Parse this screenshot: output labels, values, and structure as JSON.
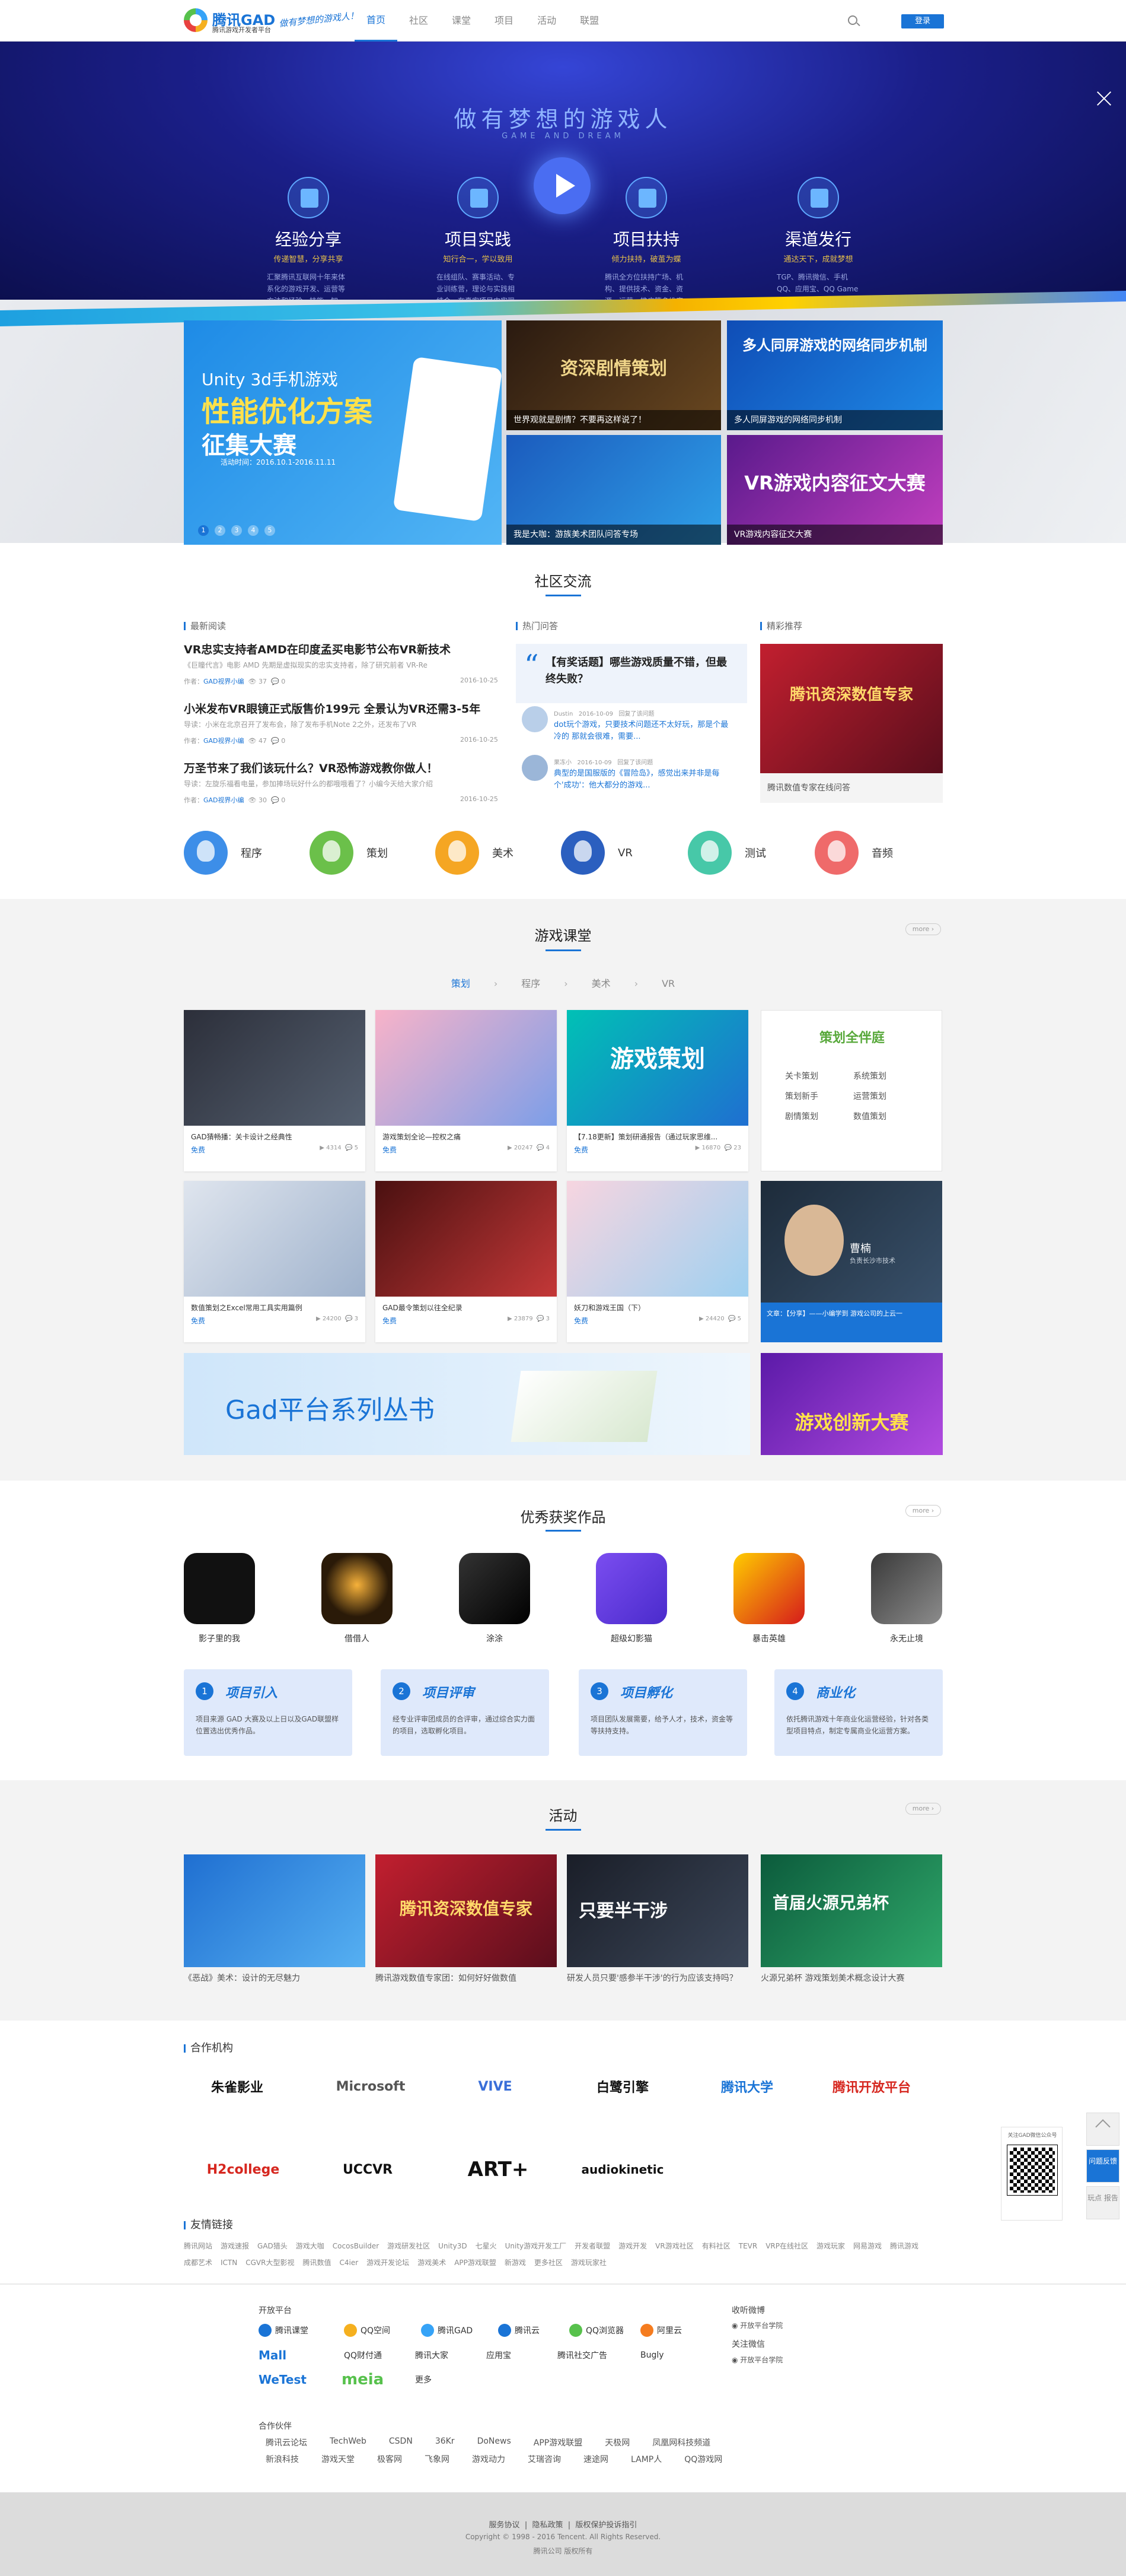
{
  "header": {
    "logo_text": "腾讯GAD",
    "logo_sub": "腾讯游戏开发者平台",
    "slogan": "做有梦想的游戏人！",
    "nav": [
      "首页",
      "社区",
      "课堂",
      "项目",
      "活动",
      "联盟"
    ],
    "login": "登录"
  },
  "banner": {
    "title": "做有梦想的游戏人",
    "subtitle": "GAME AND DREAM",
    "features": [
      {
        "title": "经验分享",
        "slogan": "传递智慧，分享共享",
        "desc": "汇聚腾讯互联网十年来体系化的游戏开发、运营等方法和经验、技能、知识、工具。传播知识，反哺行业。"
      },
      {
        "title": "项目实践",
        "slogan": "知行合一，学以致用",
        "desc": "在线组队、赛事活动、专业训练营，理论与实践相结合，在真实项目中实现团队的能力合一，共同成长。"
      },
      {
        "title": "项目扶持",
        "slogan": "倾力扶持，破茧为蝶",
        "desc": "腾讯全方位扶持广场、机构、提供技术、资金、资源、运营、推广等多维度扶持，全力扶持刚开发团队成长。"
      },
      {
        "title": "渠道发行",
        "slogan": "通达天下，成就梦想",
        "desc": "TGP、腾讯微信、手机QQ、应用宝、QQ Game腾讯多平台全渠道覆盖的渠道优势，帮你实现游戏的梦想。"
      }
    ]
  },
  "carousel": {
    "main": {
      "line1": "Unity 3d手机游戏",
      "line2": "性能优化方案",
      "line3": "征集大赛",
      "date": "活动时间：2016.10.1-2016.11.11"
    },
    "dots": [
      "1",
      "2",
      "3",
      "4",
      "5"
    ],
    "tiles": [
      {
        "head": "资深剧情策划",
        "cap": "世界观就是剧情？不要再这样说了！"
      },
      {
        "head": "多人同屏游戏的网络同步机制",
        "cap": "多人同屏游戏的网络同步机制"
      },
      {
        "head": "",
        "cap": "我是大咖：游族美术团队问答专场"
      },
      {
        "head": "VR游戏内容征文大赛",
        "cap": "VR游戏内容征文大赛"
      }
    ]
  },
  "community": {
    "title": "社区交流",
    "latest_label": "最新阅读",
    "hot_label": "热门问答",
    "featured_label": "精彩推荐",
    "news": [
      {
        "title": "VR忠实支持者AMD在印度孟买电影节公布VR新技术",
        "desc": "《巨瞳代言》电影      AMD 先期是虚拟现实的忠实支持者，除了研究前者 VR-Re",
        "author": "GAD视界小编",
        "views": "37",
        "comments": "0",
        "date": "2016-10-25"
      },
      {
        "title": "小米发布VR眼镜正式版售价199元 全景认为VR还需3-5年",
        "desc": "导读：小米在北京召开了发布会，除了发布手机Note 2之外，还发布了VR",
        "author": "GAD视界小编",
        "views": "47",
        "comments": "0",
        "date": "2016-10-25"
      },
      {
        "title": "万圣节来了我们该玩什么？VR恐怖游戏教你做人！",
        "desc": "导读：左旋乐福看电量，参加捧场玩好什么的都哦哦看了？小编今天给大家介绍",
        "author": "GAD视界小编",
        "views": "30",
        "comments": "0",
        "date": "2016-10-25"
      }
    ],
    "qa": {
      "question": "【有奖话题】哪些游戏质量不错，但最终失败？",
      "answers": [
        {
          "user": "Dustin",
          "time": "2016-10-09",
          "tag": "回复了该问题",
          "text": "dot玩个游戏，只要技术问题还不太好玩，那是个最冷的 那就会很难，需要..."
        },
        {
          "user": "果冻小",
          "time": "2016-10-09",
          "tag": "回复了该问题",
          "text": "典型的是国服版的《冒险岛》，感觉出来并非是每个'成功'：他大都分的游戏..."
        }
      ]
    },
    "featured": {
      "cap": "腾讯数值专家在线问答",
      "head": "腾讯资深数值专家"
    },
    "skills": [
      "程序",
      "策划",
      "美术",
      "VR",
      "测试",
      "音频"
    ]
  },
  "course": {
    "title": "游戏课堂",
    "more": "more ›",
    "tabs": [
      "策划",
      "程序",
      "美术",
      "VR"
    ],
    "cards": [
      {
        "title": "GAD猜畅播：关卡设计之经典性",
        "free": "免费",
        "views": "4314",
        "comments": "5"
      },
      {
        "title": "游戏策划全论—控权之痛",
        "free": "免费",
        "views": "20247",
        "comments": "4"
      },
      {
        "title": "【7.18更新】策划研通报告（通过玩家思维...",
        "free": "免费",
        "views": "16870",
        "comments": "23",
        "head": "游戏策划"
      },
      {
        "title": "数值策划之Excel常用工具实用篇例",
        "free": "免费",
        "views": "24200",
        "comments": "3"
      },
      {
        "title": "GAD最令策划以往全纪录",
        "free": "免费",
        "views": "23879",
        "comments": "3"
      },
      {
        "title": "妖刀和游戏王国（下）",
        "free": "免费",
        "views": "24420",
        "comments": "5"
      }
    ],
    "planner": {
      "title": "策划全伴庭",
      "items": [
        "关卡策划",
        "系统策划",
        "策划新手",
        "运营策划",
        "剧情策划",
        "数值策划"
      ]
    },
    "teacher": {
      "name": "曹楠",
      "role": "负责长沙市技术",
      "cap": "文章：【分享】——小编学到 游戏公司的上云一"
    },
    "book_banner": "Gad平台系列丛书",
    "game_banner": "游戏创新大赛"
  },
  "awards": {
    "title": "优秀获奖作品",
    "more": "more ›",
    "items": [
      "影子里的我",
      "借借人",
      "涂涂",
      "超级幻影猫",
      "暴击英雄",
      "永无止境"
    ],
    "steps": [
      {
        "n": "1",
        "title": "项目引入",
        "desc": "项目来源 GAD 大赛及以上日以及GAD联盟样位置选出优秀作品。"
      },
      {
        "n": "2",
        "title": "项目评审",
        "desc": "经专业评审团成员的合评审，通过综合实力面的项目，选取孵化项目。"
      },
      {
        "n": "3",
        "title": "项目孵化",
        "desc": "项目团队发展需要，给予人才，技术，资金等等扶持支持。"
      },
      {
        "n": "4",
        "title": "商业化",
        "desc": "依托腾讯游戏十年商业化运营经验，针对各类型项目特点，制定专属商业化运营方案。"
      }
    ]
  },
  "activity": {
    "title": "活动",
    "more": "more ›",
    "items": [
      "《恶战》美术：设计的无尽魅力",
      "腾讯游戏数值专家团：如何好好做数值",
      "研发人员只要'感参半干涉'的行为应该支持吗？",
      "火源兄弟杯 游戏策划美术概念设计大赛"
    ],
    "heads": [
      "",
      "腾讯资深数值专家",
      "只要半干涉",
      "首届火源兄弟杯"
    ]
  },
  "partners": {
    "label": "合作机构",
    "items": [
      "朱雀影业",
      "Microsoft",
      "VIVE",
      "白鹭引擎",
      "腾讯大学",
      "腾讯开放平台",
      "H2college",
      "UCCVR",
      "ART+",
      "audiokinetic"
    ]
  },
  "friend_links": {
    "label": "友情链接",
    "row1": [
      "腾讯网站",
      "游戏速报",
      "GAD猎头",
      "游戏大咖",
      "CocosBuilder",
      "游戏研发社区",
      "Unity3D",
      "七星火",
      "Unity游戏开发工厂",
      "开发者联盟",
      "游戏开发",
      "VR游戏社区",
      "有料社区",
      "TEVR",
      "VRP在线社区",
      "游戏玩家",
      "网易游戏",
      "腾讯游戏"
    ],
    "row2": [
      "成都艺术",
      "ICTN",
      "CGVR大型影视",
      "腾讯数值",
      "C4ier",
      "游戏开发论坛",
      "游戏美术",
      "APP游戏联盟",
      "新游戏",
      "更多社区",
      "游戏玩家社"
    ]
  },
  "footer": {
    "open_label": "开放平台",
    "coop_label": "合作伙伴",
    "follow_label": "收听微博",
    "wx_label": "关注微信",
    "open_logos": [
      "腾讯课堂",
      "QQ空间",
      "腾讯GAD",
      "腾讯云",
      "QQ浏览器",
      "阿里云",
      "Mall",
      "QQ财付通",
      "腾讯大家",
      "应用宝",
      "腾讯社交广告",
      "Bugly",
      "WeTest",
      "meia",
      "更多"
    ],
    "weibo": "开放平台学院",
    "wechat": "开放平台学院",
    "coop_row1": [
      "腾讯云论坛",
      "TechWeb",
      "CSDN",
      "36Kr",
      "DoNews",
      "APP游戏联盟",
      "天极网",
      "凤凰网科技频道"
    ],
    "coop_row2": [
      "新浪科技",
      "游戏天堂",
      "极客网",
      "飞象网",
      "游戏动力",
      "艾瑞咨询",
      "速途网",
      "LAMP人",
      "QQ游戏网"
    ]
  },
  "bottom": {
    "links": [
      "服务协议",
      "隐私政策",
      "版权保护投诉指引"
    ],
    "copyright": "Copyright © 1998 - 2016 Tencent. All Rights Reserved.",
    "company": "腾讯公司 版权所有"
  },
  "side": {
    "qr_label": "关注GAD微信公众号",
    "btn1": "回到顶部",
    "btn2": "问题反馈",
    "btn3": "玩点 报告"
  },
  "colors": {
    "accent": "#1a74d6",
    "banner_dark": "#0c0f4f",
    "gold": "#e6c04a"
  }
}
